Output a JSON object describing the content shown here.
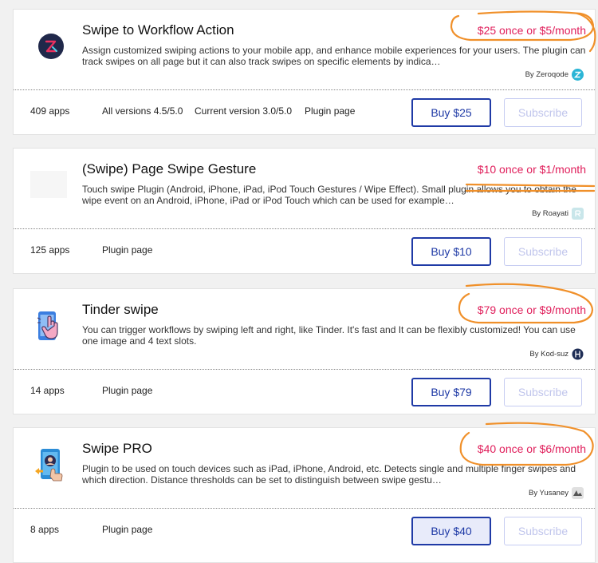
{
  "plugins": [
    {
      "title": "Swipe to Workflow Action",
      "price": "$25 once or $5/month",
      "description": "Assign customized swiping actions to your mobile app, and enhance mobile experiences for your users. The plugin can track swipes on all page but it can also track swipes on specific elements by indica…",
      "author": "By Zeroqode",
      "apps": "409 apps",
      "all_versions": "All versions 4.5/5.0",
      "current_version": "Current version 3.0/5.0",
      "plugin_page": "Plugin page",
      "buy_label": "Buy $25",
      "subscribe_label": "Subscribe"
    },
    {
      "title": "(Swipe) Page Swipe Gesture",
      "price": "$10 once or $1/month",
      "description": "Touch swipe Plugin (Android, iPhone, iPad, iPod Touch Gestures / Wipe Effect). Small plugin allows you to obtain the wipe event on an Android, iPhone, iPad or iPod Touch which can be used for example…",
      "author": "By Roayati",
      "apps": "125 apps",
      "plugin_page": "Plugin page",
      "buy_label": "Buy $10",
      "subscribe_label": "Subscribe"
    },
    {
      "title": "Tinder swipe",
      "price": "$79 once or $9/month",
      "description": "You can trigger workflows by swiping left and right, like Tinder. It's fast and It can be flexibly customized! You can use one image and 4 text slots.",
      "author": "By Kod-suz",
      "apps": "14 apps",
      "plugin_page": "Plugin page",
      "buy_label": "Buy $79",
      "subscribe_label": "Subscribe"
    },
    {
      "title": "Swipe PRO",
      "price": "$40 once or $6/month",
      "description": "Plugin to be used on touch devices such as iPad, iPhone, Android, etc. Detects single and multiple finger swipes and which direction. Distance thresholds can be set to distinguish between swipe gestu…",
      "author": "By Yusaney",
      "apps": "8 apps",
      "plugin_page": "Plugin page",
      "buy_label": "Buy $40",
      "subscribe_label": "Subscribe"
    }
  ],
  "colors": {
    "price": "#e01d5a",
    "button_primary": "#1f3aa6",
    "button_disabled": "#c0c5ec",
    "annotation": "#f0902a"
  }
}
